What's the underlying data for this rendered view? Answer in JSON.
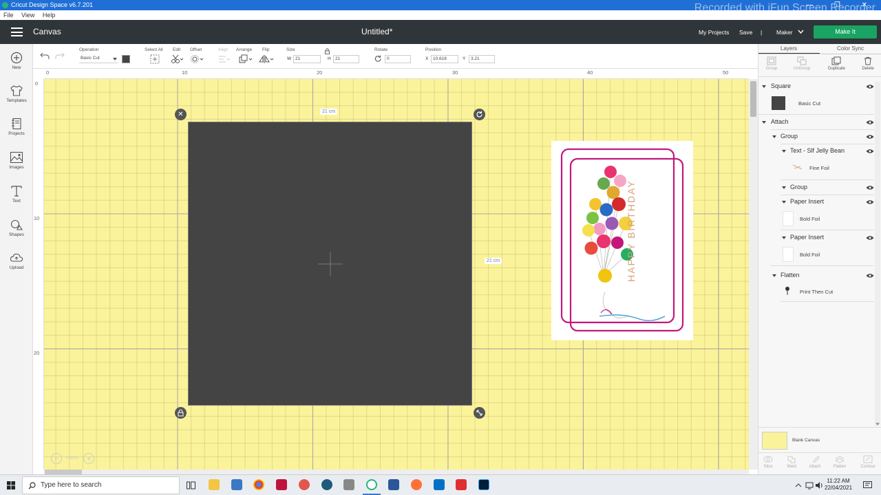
{
  "window": {
    "title": "Cricut Design Space  v6.7.201",
    "watermark": "Recorded with iFun Screen Recorder",
    "controls": "— ❐ ✕"
  },
  "menu": [
    "File",
    "View",
    "Help"
  ],
  "header": {
    "section": "Canvas",
    "doc_title": "Untitled*",
    "my_projects": "My Projects",
    "save": "Save",
    "separator": "|",
    "machine": "Maker",
    "make_it": "Make It"
  },
  "leftbar": [
    {
      "label": "New",
      "icon": "plus-circle-icon"
    },
    {
      "label": "Templates",
      "icon": "tshirt-icon"
    },
    {
      "label": "Projects",
      "icon": "projects-icon"
    },
    {
      "label": "Images",
      "icon": "image-icon"
    },
    {
      "label": "Text",
      "icon": "text-icon"
    },
    {
      "label": "Shapes",
      "icon": "shapes-icon"
    },
    {
      "label": "Upload",
      "icon": "cloud-upload-icon"
    }
  ],
  "toolbar": {
    "operation_label": "Operation",
    "operation_value": "Basic Cut",
    "select_all": "Select All",
    "edit": "Edit",
    "offset": "Offset",
    "align": "Align",
    "arrange": "Arrange",
    "flip": "Flip",
    "size_label": "Size",
    "w_label": "W",
    "w_value": "21",
    "h_label": "H",
    "h_value": "21",
    "rotate_label": "Rotate",
    "rotate_value": "0",
    "position_label": "Position",
    "x_label": "X",
    "x_value": "10.618",
    "y_label": "Y",
    "y_value": "3.21"
  },
  "ruler": {
    "top": [
      "0",
      "10",
      "20",
      "30",
      "40",
      "50"
    ],
    "left": [
      "0",
      "10",
      "20"
    ]
  },
  "canvas": {
    "width_label": "21 cm",
    "height_label": "21 cm",
    "card_text": "HAPPY BIRTHDAY",
    "zoom": "100%"
  },
  "rightpanel": {
    "tabs": [
      "Layers",
      "Color Sync"
    ],
    "actions": [
      "Group",
      "UnGroup",
      "Duplicate",
      "Delete"
    ],
    "layers": [
      {
        "name": "Square",
        "sub": "Basic Cut"
      },
      {
        "name": "Attach"
      },
      {
        "name": "Group"
      },
      {
        "name": "Text - Slf Jelly Bean",
        "sub": "Fine Foil"
      },
      {
        "name": "Group"
      },
      {
        "name": "Paper Insert",
        "sub": "Bold Foil"
      },
      {
        "name": "Paper Insert",
        "sub": "Bold Foil"
      },
      {
        "name": "Flatten",
        "sub": "Print Then Cut"
      }
    ],
    "blank_canvas": "Blank Canvas",
    "bottom_actions": [
      "Slice",
      "Weld",
      "Attach",
      "Flatten",
      "Contour"
    ]
  },
  "taskbar": {
    "search_placeholder": "Type here to search",
    "time": "11:22 AM",
    "date": "22/04/2021"
  },
  "colors": {
    "header": "#2f3539",
    "accent": "#1aa363",
    "canvas": "#fbf39a",
    "square": "#444444",
    "card_frame": "#c2187a"
  }
}
